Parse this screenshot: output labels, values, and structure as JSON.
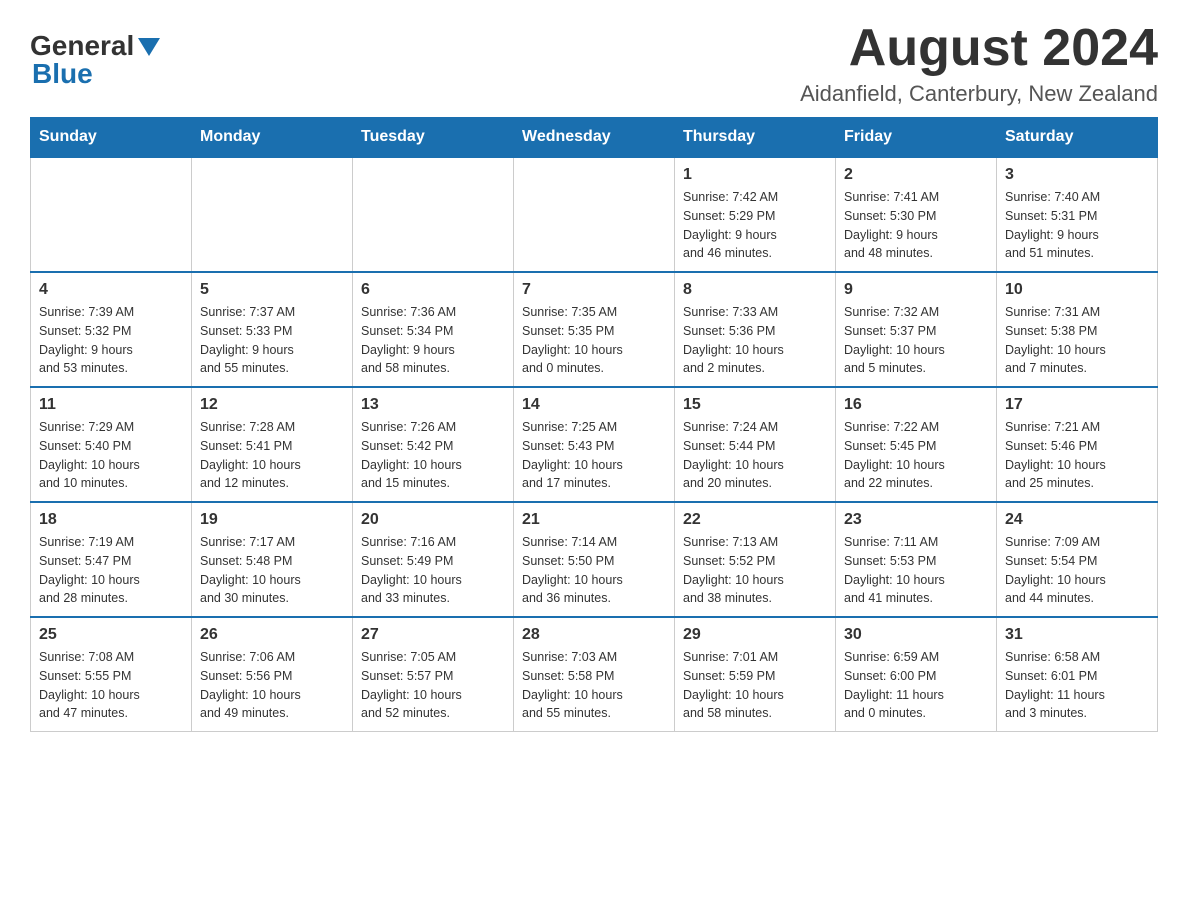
{
  "header": {
    "logo_general": "General",
    "logo_blue": "Blue",
    "title": "August 2024",
    "location": "Aidanfield, Canterbury, New Zealand"
  },
  "weekdays": [
    "Sunday",
    "Monday",
    "Tuesday",
    "Wednesday",
    "Thursday",
    "Friday",
    "Saturday"
  ],
  "weeks": [
    [
      {
        "day": "",
        "info": ""
      },
      {
        "day": "",
        "info": ""
      },
      {
        "day": "",
        "info": ""
      },
      {
        "day": "",
        "info": ""
      },
      {
        "day": "1",
        "info": "Sunrise: 7:42 AM\nSunset: 5:29 PM\nDaylight: 9 hours\nand 46 minutes."
      },
      {
        "day": "2",
        "info": "Sunrise: 7:41 AM\nSunset: 5:30 PM\nDaylight: 9 hours\nand 48 minutes."
      },
      {
        "day": "3",
        "info": "Sunrise: 7:40 AM\nSunset: 5:31 PM\nDaylight: 9 hours\nand 51 minutes."
      }
    ],
    [
      {
        "day": "4",
        "info": "Sunrise: 7:39 AM\nSunset: 5:32 PM\nDaylight: 9 hours\nand 53 minutes."
      },
      {
        "day": "5",
        "info": "Sunrise: 7:37 AM\nSunset: 5:33 PM\nDaylight: 9 hours\nand 55 minutes."
      },
      {
        "day": "6",
        "info": "Sunrise: 7:36 AM\nSunset: 5:34 PM\nDaylight: 9 hours\nand 58 minutes."
      },
      {
        "day": "7",
        "info": "Sunrise: 7:35 AM\nSunset: 5:35 PM\nDaylight: 10 hours\nand 0 minutes."
      },
      {
        "day": "8",
        "info": "Sunrise: 7:33 AM\nSunset: 5:36 PM\nDaylight: 10 hours\nand 2 minutes."
      },
      {
        "day": "9",
        "info": "Sunrise: 7:32 AM\nSunset: 5:37 PM\nDaylight: 10 hours\nand 5 minutes."
      },
      {
        "day": "10",
        "info": "Sunrise: 7:31 AM\nSunset: 5:38 PM\nDaylight: 10 hours\nand 7 minutes."
      }
    ],
    [
      {
        "day": "11",
        "info": "Sunrise: 7:29 AM\nSunset: 5:40 PM\nDaylight: 10 hours\nand 10 minutes."
      },
      {
        "day": "12",
        "info": "Sunrise: 7:28 AM\nSunset: 5:41 PM\nDaylight: 10 hours\nand 12 minutes."
      },
      {
        "day": "13",
        "info": "Sunrise: 7:26 AM\nSunset: 5:42 PM\nDaylight: 10 hours\nand 15 minutes."
      },
      {
        "day": "14",
        "info": "Sunrise: 7:25 AM\nSunset: 5:43 PM\nDaylight: 10 hours\nand 17 minutes."
      },
      {
        "day": "15",
        "info": "Sunrise: 7:24 AM\nSunset: 5:44 PM\nDaylight: 10 hours\nand 20 minutes."
      },
      {
        "day": "16",
        "info": "Sunrise: 7:22 AM\nSunset: 5:45 PM\nDaylight: 10 hours\nand 22 minutes."
      },
      {
        "day": "17",
        "info": "Sunrise: 7:21 AM\nSunset: 5:46 PM\nDaylight: 10 hours\nand 25 minutes."
      }
    ],
    [
      {
        "day": "18",
        "info": "Sunrise: 7:19 AM\nSunset: 5:47 PM\nDaylight: 10 hours\nand 28 minutes."
      },
      {
        "day": "19",
        "info": "Sunrise: 7:17 AM\nSunset: 5:48 PM\nDaylight: 10 hours\nand 30 minutes."
      },
      {
        "day": "20",
        "info": "Sunrise: 7:16 AM\nSunset: 5:49 PM\nDaylight: 10 hours\nand 33 minutes."
      },
      {
        "day": "21",
        "info": "Sunrise: 7:14 AM\nSunset: 5:50 PM\nDaylight: 10 hours\nand 36 minutes."
      },
      {
        "day": "22",
        "info": "Sunrise: 7:13 AM\nSunset: 5:52 PM\nDaylight: 10 hours\nand 38 minutes."
      },
      {
        "day": "23",
        "info": "Sunrise: 7:11 AM\nSunset: 5:53 PM\nDaylight: 10 hours\nand 41 minutes."
      },
      {
        "day": "24",
        "info": "Sunrise: 7:09 AM\nSunset: 5:54 PM\nDaylight: 10 hours\nand 44 minutes."
      }
    ],
    [
      {
        "day": "25",
        "info": "Sunrise: 7:08 AM\nSunset: 5:55 PM\nDaylight: 10 hours\nand 47 minutes."
      },
      {
        "day": "26",
        "info": "Sunrise: 7:06 AM\nSunset: 5:56 PM\nDaylight: 10 hours\nand 49 minutes."
      },
      {
        "day": "27",
        "info": "Sunrise: 7:05 AM\nSunset: 5:57 PM\nDaylight: 10 hours\nand 52 minutes."
      },
      {
        "day": "28",
        "info": "Sunrise: 7:03 AM\nSunset: 5:58 PM\nDaylight: 10 hours\nand 55 minutes."
      },
      {
        "day": "29",
        "info": "Sunrise: 7:01 AM\nSunset: 5:59 PM\nDaylight: 10 hours\nand 58 minutes."
      },
      {
        "day": "30",
        "info": "Sunrise: 6:59 AM\nSunset: 6:00 PM\nDaylight: 11 hours\nand 0 minutes."
      },
      {
        "day": "31",
        "info": "Sunrise: 6:58 AM\nSunset: 6:01 PM\nDaylight: 11 hours\nand 3 minutes."
      }
    ]
  ]
}
